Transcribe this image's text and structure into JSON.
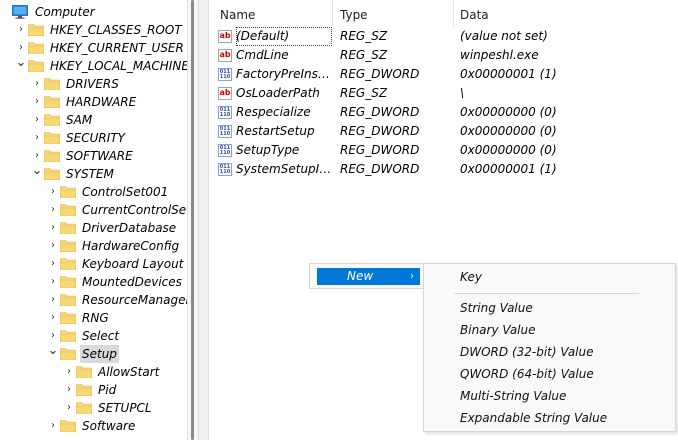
{
  "tree": {
    "items": [
      {
        "label": "Computer",
        "expanded": true,
        "icon": "computer-icon"
      },
      {
        "label": "HKEY_CLASSES_ROOT",
        "expanded": false,
        "icon": "folder-icon"
      },
      {
        "label": "HKEY_CURRENT_USER",
        "expanded": false,
        "icon": "folder-icon"
      },
      {
        "label": "HKEY_LOCAL_MACHINE",
        "expanded": true,
        "icon": "folder-icon"
      },
      {
        "label": "DRIVERS",
        "expanded": false,
        "icon": "folder-icon"
      },
      {
        "label": "HARDWARE",
        "expanded": false,
        "icon": "folder-icon"
      },
      {
        "label": "SAM",
        "expanded": false,
        "icon": "folder-icon"
      },
      {
        "label": "SECURITY",
        "expanded": false,
        "icon": "folder-icon"
      },
      {
        "label": "SOFTWARE",
        "expanded": false,
        "icon": "folder-icon"
      },
      {
        "label": "SYSTEM",
        "expanded": true,
        "icon": "folder-icon"
      },
      {
        "label": "ControlSet001",
        "expanded": false,
        "icon": "folder-icon"
      },
      {
        "label": "CurrentControlSet",
        "expanded": false,
        "icon": "folder-icon"
      },
      {
        "label": "DriverDatabase",
        "expanded": false,
        "icon": "folder-icon"
      },
      {
        "label": "HardwareConfig",
        "expanded": false,
        "icon": "folder-icon"
      },
      {
        "label": "Keyboard Layout",
        "expanded": false,
        "icon": "folder-icon"
      },
      {
        "label": "MountedDevices",
        "expanded": false,
        "icon": "folder-icon"
      },
      {
        "label": "ResourceManager",
        "expanded": false,
        "icon": "folder-icon"
      },
      {
        "label": "RNG",
        "expanded": false,
        "icon": "folder-icon"
      },
      {
        "label": "Select",
        "expanded": false,
        "icon": "folder-icon"
      },
      {
        "label": "Setup",
        "expanded": true,
        "icon": "folder-icon",
        "selected": true
      },
      {
        "label": "AllowStart",
        "expanded": false,
        "icon": "folder-icon"
      },
      {
        "label": "Pid",
        "expanded": false,
        "icon": "folder-icon"
      },
      {
        "label": "SETUPCL",
        "expanded": false,
        "icon": "folder-icon"
      },
      {
        "label": "Software",
        "expanded": false,
        "icon": "folder-icon"
      }
    ]
  },
  "list": {
    "headers": {
      "name": "Name",
      "type": "Type",
      "data": "Data"
    },
    "rows": [
      {
        "name": "(Default)",
        "type": "REG_SZ",
        "data": "(value not set)",
        "icon": "string-value-icon"
      },
      {
        "name": "CmdLine",
        "type": "REG_SZ",
        "data": "winpeshl.exe",
        "icon": "string-value-icon"
      },
      {
        "name": "FactoryPreInstall...",
        "type": "REG_DWORD",
        "data": "0x00000001 (1)",
        "icon": "binary-value-icon"
      },
      {
        "name": "OsLoaderPath",
        "type": "REG_SZ",
        "data": "\\",
        "icon": "string-value-icon"
      },
      {
        "name": "Respecialize",
        "type": "REG_DWORD",
        "data": "0x00000000 (0)",
        "icon": "binary-value-icon"
      },
      {
        "name": "RestartSetup",
        "type": "REG_DWORD",
        "data": "0x00000000 (0)",
        "icon": "binary-value-icon"
      },
      {
        "name": "SetupType",
        "type": "REG_DWORD",
        "data": "0x00000000 (0)",
        "icon": "binary-value-icon"
      },
      {
        "name": "SystemSetupInP...",
        "type": "REG_DWORD",
        "data": "0x00000001 (1)",
        "icon": "binary-value-icon"
      }
    ]
  },
  "context_menu": {
    "main": {
      "label": "New"
    },
    "submenu": {
      "key": "Key",
      "items": [
        "String Value",
        "Binary Value",
        "DWORD (32-bit) Value",
        "QWORD (64-bit) Value",
        "Multi-String Value",
        "Expandable String Value"
      ]
    }
  },
  "colors": {
    "highlight": "#0078d7",
    "folder": "#f8d775",
    "selected_bg": "#d9d9d9"
  }
}
